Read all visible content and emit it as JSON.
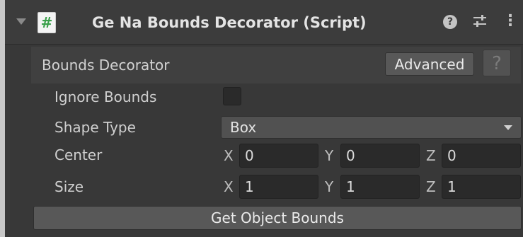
{
  "header": {
    "title": "Ge Na Bounds Decorator (Script)",
    "script_icon_glyph": "#",
    "help_glyph": "?",
    "menu_glyph": "⋮"
  },
  "decorator": {
    "title": "Bounds Decorator",
    "advanced_label": "Advanced",
    "help_glyph": "?"
  },
  "properties": {
    "ignore_bounds": {
      "label": "Ignore Bounds",
      "checked": false
    },
    "shape_type": {
      "label": "Shape Type",
      "value": "Box"
    },
    "center": {
      "label": "Center",
      "x_label": "X",
      "y_label": "Y",
      "z_label": "Z",
      "x": "0",
      "y": "0",
      "z": "0"
    },
    "size": {
      "label": "Size",
      "x_label": "X",
      "y_label": "Y",
      "z_label": "Z",
      "x": "1",
      "y": "1",
      "z": "1"
    }
  },
  "actions": {
    "get_object_bounds_label": "Get Object Bounds"
  },
  "colors": {
    "panel_bg": "#383838",
    "field_bg": "#2a2a2a",
    "button_bg": "#585858",
    "script_icon_green": "#3aa04a"
  }
}
